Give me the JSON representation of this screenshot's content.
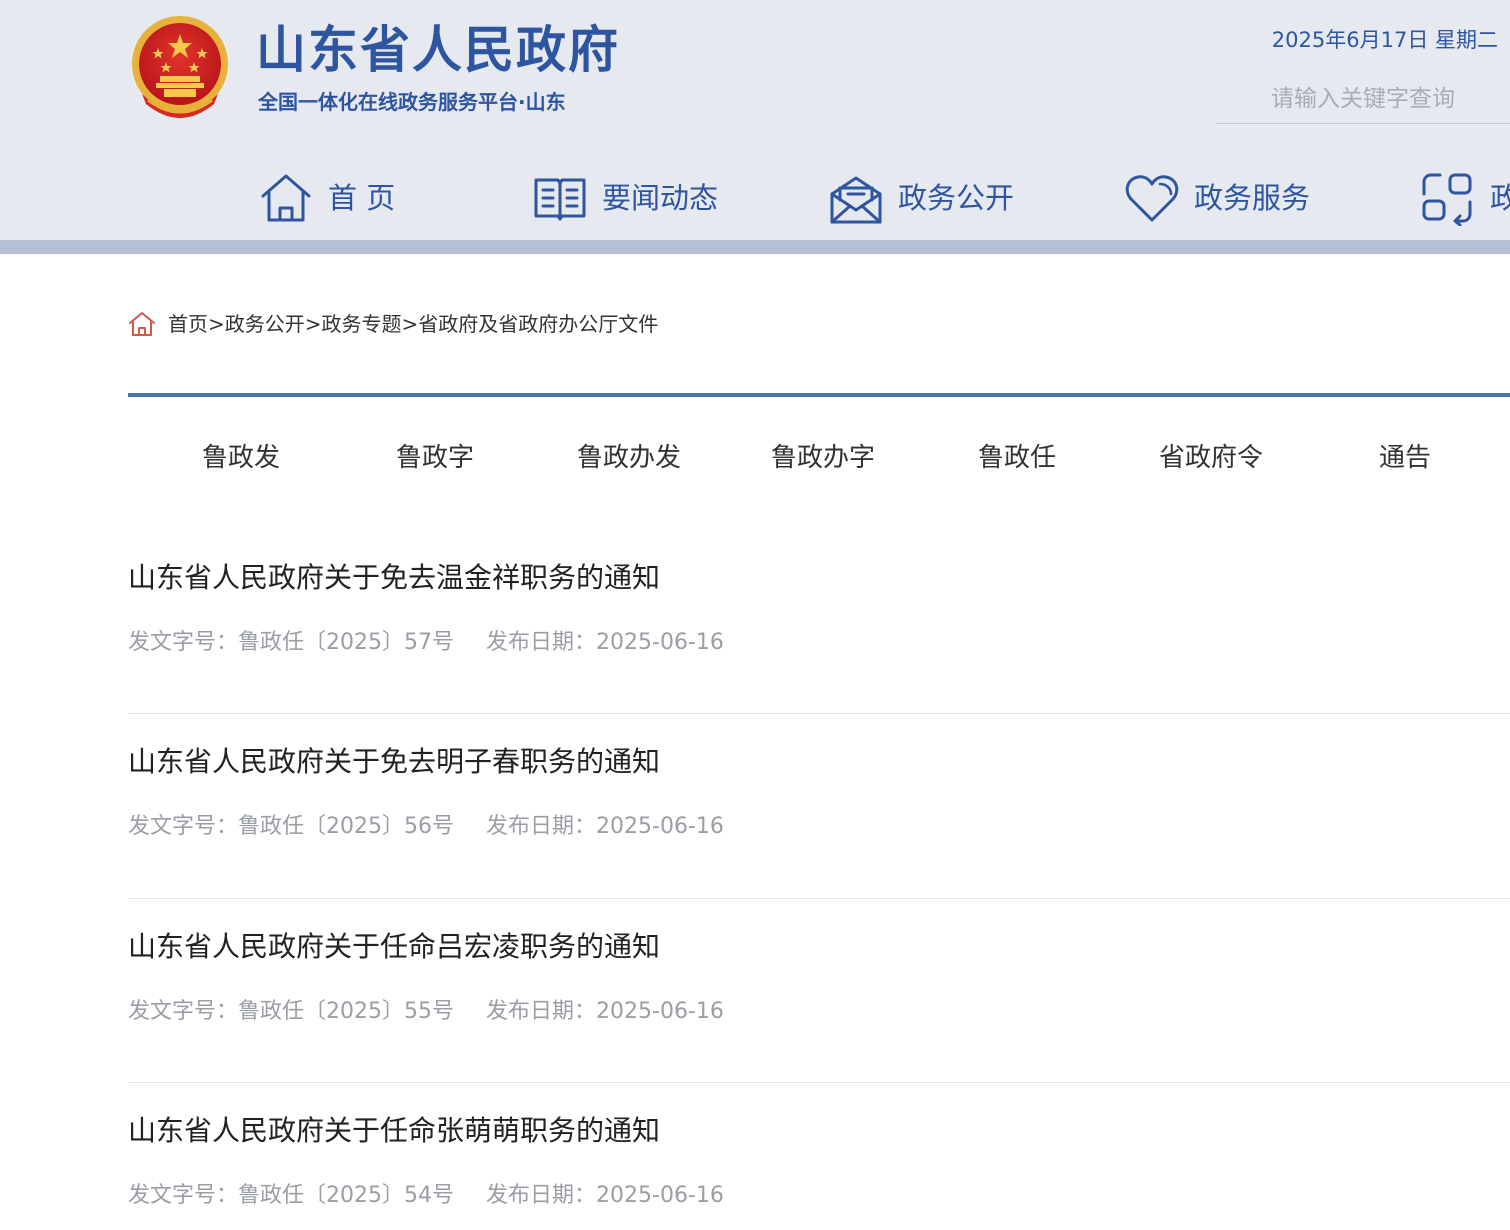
{
  "header": {
    "title": "山东省人民政府",
    "subtitle": "全国一体化在线政务服务平台·山东",
    "date": "2025年6月17日 星期二",
    "search_placeholder": "请输入关键字查询",
    "emblem_icon": "national-emblem-icon",
    "brand_color": "#2e55a0"
  },
  "nav": {
    "items": [
      {
        "label": "首 页",
        "icon": "home-icon"
      },
      {
        "label": "要闻动态",
        "icon": "book-icon"
      },
      {
        "label": "政务公开",
        "icon": "mail-icon"
      },
      {
        "label": "政务服务",
        "icon": "heart-icon"
      },
      {
        "label": "政",
        "icon": "exchange-icon"
      }
    ]
  },
  "breadcrumb": {
    "icon": "home-icon",
    "items": [
      "首页",
      "政务公开",
      "政务专题"
    ],
    "separator": ">",
    "current": "省政府及省政府办公厅文件"
  },
  "tabs": [
    "鲁政发",
    "鲁政字",
    "鲁政办发",
    "鲁政办字",
    "鲁政任",
    "省政府令",
    "通告"
  ],
  "documents": {
    "number_label": "发文字号：",
    "date_label": "发布日期：",
    "items": [
      {
        "title": "山东省人民政府关于免去温金祥职务的通知",
        "number": "鲁政任〔2025〕57号",
        "date": "2025-06-16"
      },
      {
        "title": "山东省人民政府关于免去明子春职务的通知",
        "number": "鲁政任〔2025〕56号",
        "date": "2025-06-16"
      },
      {
        "title": "山东省人民政府关于任命吕宏凌职务的通知",
        "number": "鲁政任〔2025〕55号",
        "date": "2025-06-16"
      },
      {
        "title": "山东省人民政府关于任命张萌萌职务的通知",
        "number": "鲁政任〔2025〕54号",
        "date": "2025-06-16"
      }
    ]
  }
}
